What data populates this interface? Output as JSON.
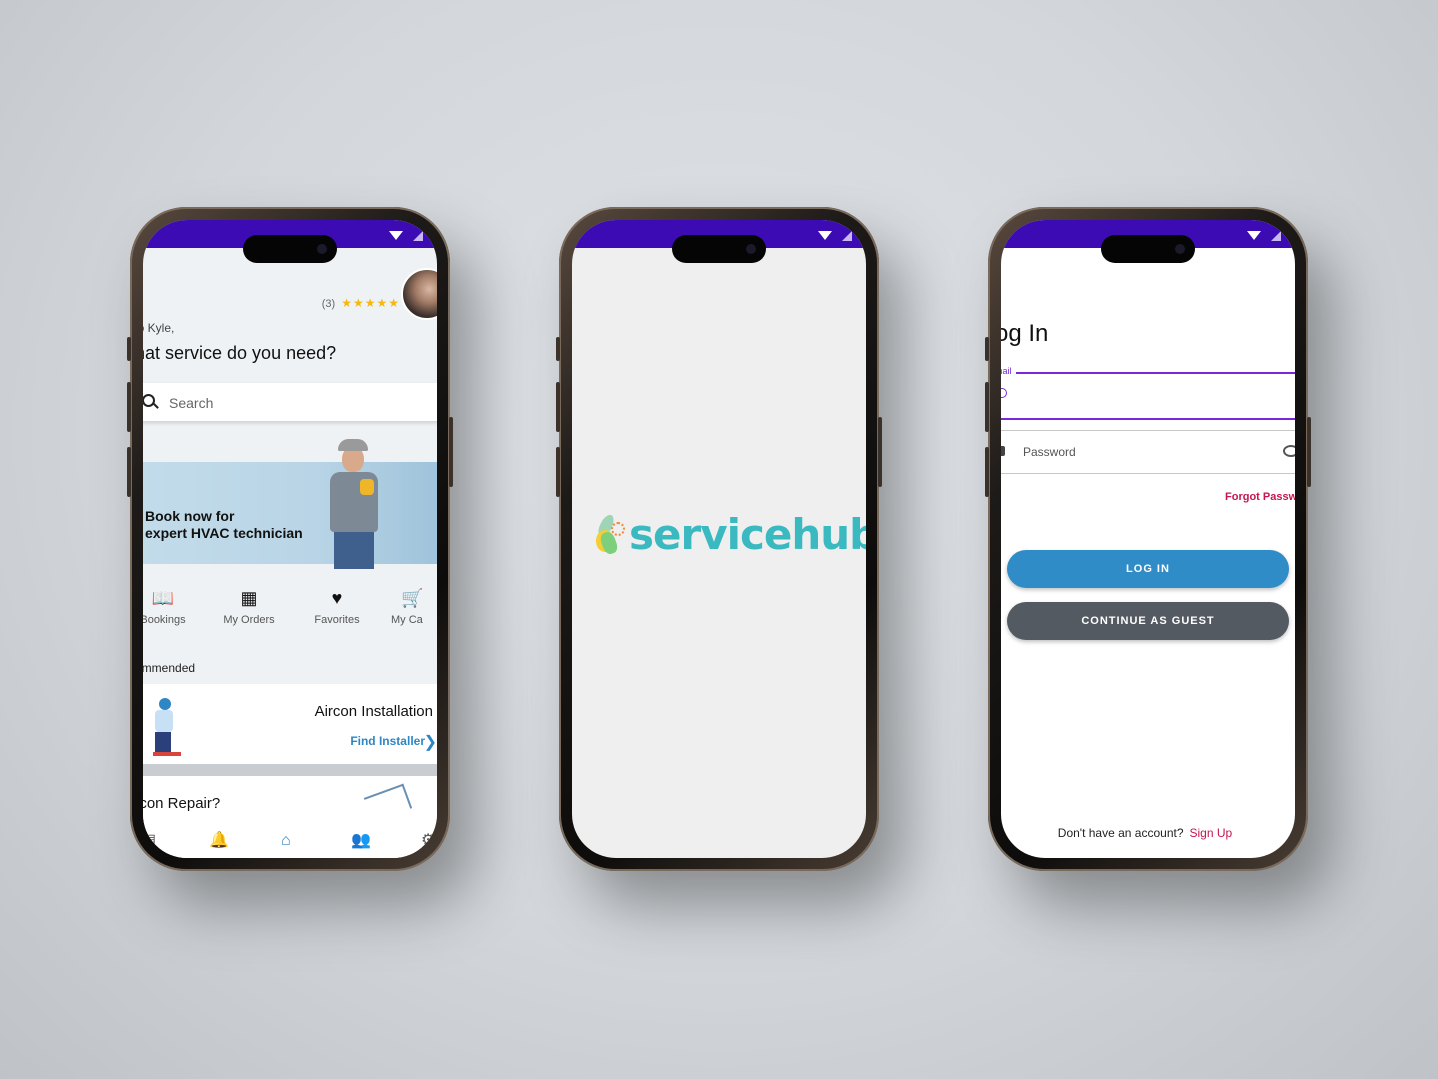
{
  "home": {
    "rating_count": "(3)",
    "rating_stars": "★★★★★",
    "greeting": "lo Kyle,",
    "question": "hat service do you need?",
    "search_placeholder": "Search",
    "banner_line1": "Book now for",
    "banner_line2": "expert HVAC technician",
    "categories": [
      {
        "label": "Bookings",
        "icon": "book-icon"
      },
      {
        "label": "My Orders",
        "icon": "store-icon"
      },
      {
        "label": "Favorites",
        "icon": "heart-icon"
      },
      {
        "label": "My Ca",
        "icon": "cart-icon"
      }
    ],
    "section_title": "ommended",
    "service_card": {
      "title": "Aircon Installation",
      "link": "Find Installer"
    },
    "second_card_title": "ircon Repair?",
    "tabs": [
      "book-icon",
      "bell-icon",
      "home-icon",
      "people-icon",
      "settings-icon"
    ],
    "accent_color": "#2f86c4"
  },
  "splash": {
    "logo_text": "servicehub",
    "brand_color": "#3ab9c0"
  },
  "login": {
    "title": "og In",
    "email_label": "mail",
    "password_label": "Password",
    "forgot": "Forgot Passw",
    "login_button": "LOG IN",
    "guest_button": "CONTINUE AS GUEST",
    "no_account": "Don't have an account?",
    "signup": "Sign Up",
    "primary_color": "#2f8cc6",
    "focus_color": "#7a28d9",
    "link_color": "#c4164f"
  },
  "status_bar_color": "#3d0bb3"
}
